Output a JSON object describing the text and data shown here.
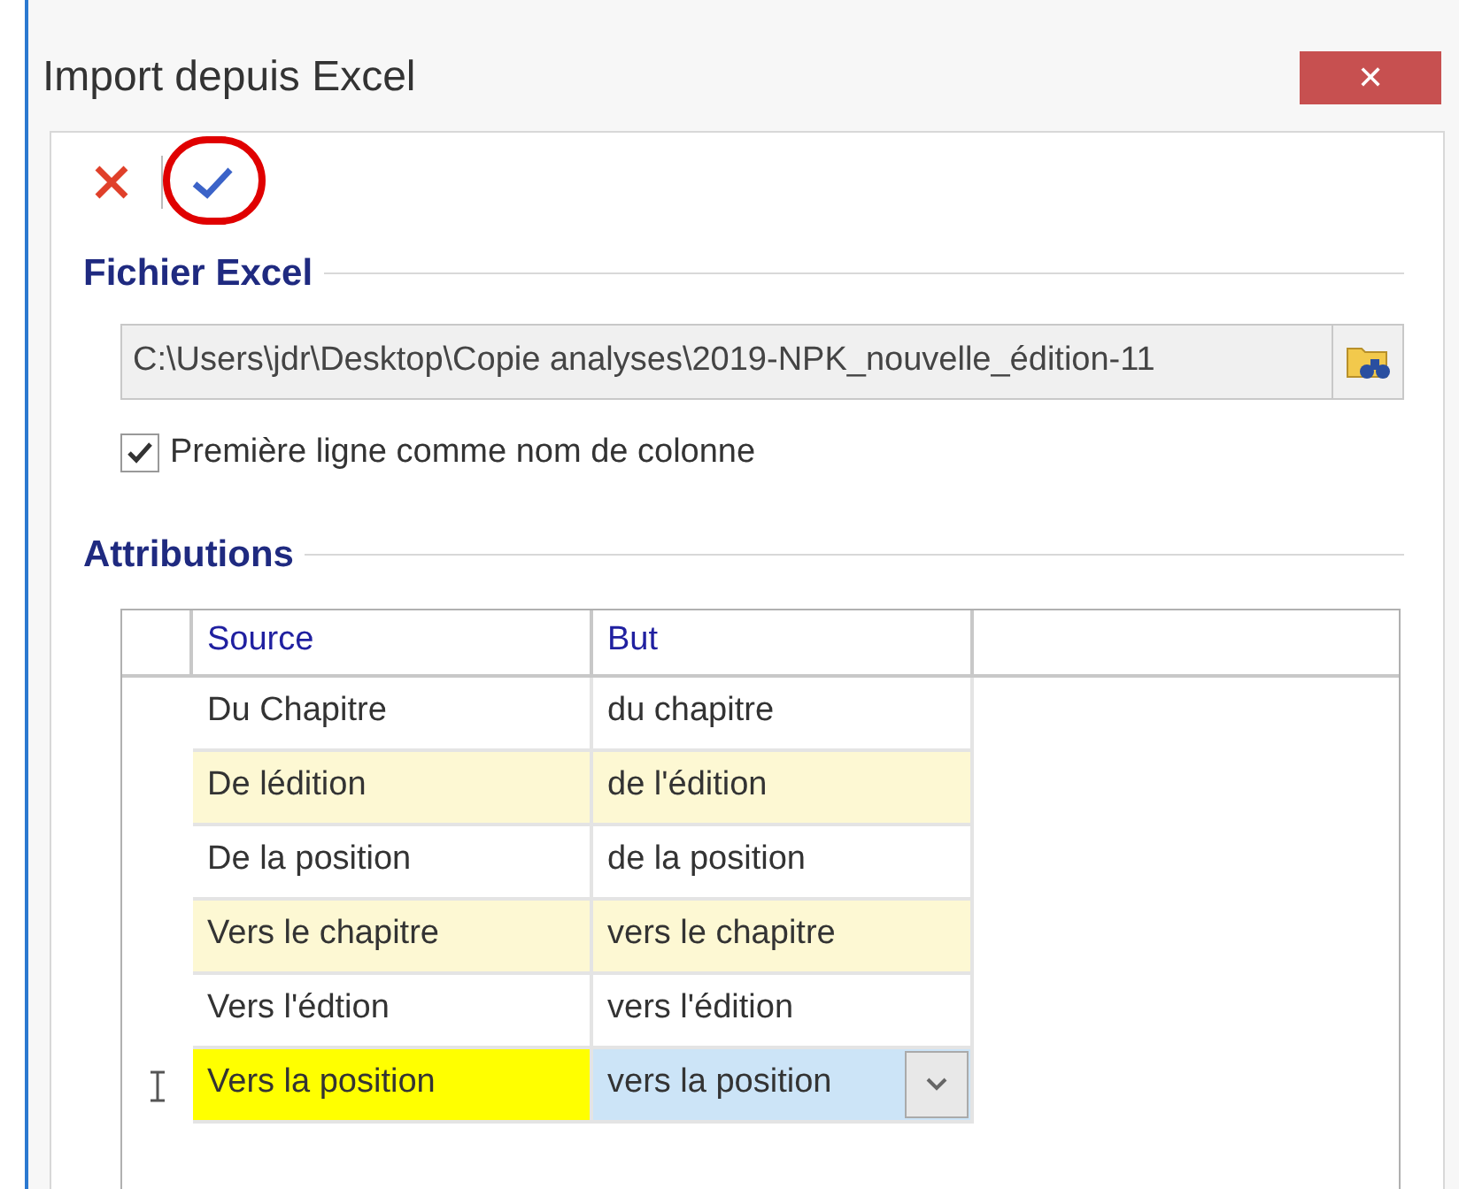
{
  "window": {
    "title": "Import depuis Excel",
    "close": "✕"
  },
  "toolbar": [
    {
      "kind": "cancel",
      "circled": false
    },
    {
      "kind": "confirm",
      "circled": true
    }
  ],
  "file_section": {
    "title": "Fichier Excel",
    "path": "C:\\Users\\jdr\\Desktop\\Copie analyses\\2019-NPK_nouvelle_édition-11",
    "first_row_header": {
      "label": "Première ligne comme nom de colonne",
      "checked": true
    }
  },
  "attributions": {
    "title": "Attributions",
    "columns": [
      "Source",
      "But"
    ],
    "rows": [
      {
        "source": "Du Chapitre",
        "target": "du chapitre",
        "current": false
      },
      {
        "source": "De lédition",
        "target": "de l'édition",
        "current": false
      },
      {
        "source": "De la position",
        "target": "de la position",
        "current": false
      },
      {
        "source": "Vers le chapitre",
        "target": "vers le chapitre",
        "current": false
      },
      {
        "source": "Vers l'édtion",
        "target": "vers l'édition",
        "current": false
      },
      {
        "source": "Vers la position",
        "target": "vers la position",
        "current": true
      }
    ]
  }
}
